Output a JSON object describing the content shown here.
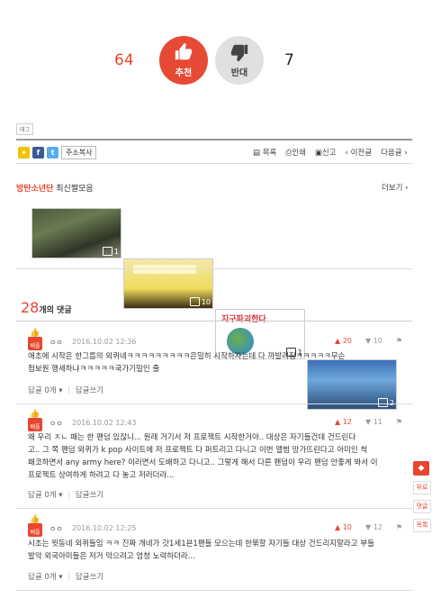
{
  "vote": {
    "up_count": "64",
    "up_label": "추천",
    "down_label": "반대",
    "down_count": "7"
  },
  "tag_label": "태그",
  "share": {
    "copy_address": "주소복사"
  },
  "toolbar": {
    "list": "목록",
    "print": "인쇄",
    "report": "신고",
    "prev": "‹ 이전글",
    "next": "다음글 ›"
  },
  "gallery": {
    "title_highlight": "방탄소년단",
    "title_rest": " 최신짤모음",
    "more": "더보기 ›",
    "items": [
      {
        "count": "1"
      },
      {
        "count": "10"
      },
      {
        "count": "1",
        "caption": "지구파괴한다"
      },
      {
        "count": "2"
      }
    ]
  },
  "comments_header": {
    "count": "28",
    "label": "개의 댓글"
  },
  "comments": [
    {
      "badge": "베플",
      "author": "ㅇㅇ",
      "date": "2016.10.02 12:36",
      "up": "20",
      "down": "10",
      "line1": "애초에 시작은 한그룹의 외퀴네ㅋㅋㅋㅋㅋㅋㅋㅋㅋ은밀히 시작하자는데 다 까발려짐ㅋㅋㅋㅋㅋ무슨",
      "line2": "첩보원 행세하냐ㅋㅋㅋㅋㅋ국가기밀인 줄",
      "line3": "",
      "reply": "답글 0개 ▾",
      "write": "답글쓰기"
    },
    {
      "badge": "베플",
      "author": "ㅇㅇ",
      "date": "2016.10.02 12:43",
      "up": "12",
      "down": "11",
      "line1": "왜 우리 ㅈㄴ 패는 한 팬덤 있잖니... 원래 거기서 저 프로젝트 시작한거야.. 대상은 자기들건데 건드린다",
      "line2": "고.. 그 쪽 팬덤 외퀴가 k pop 사이트에 저 프로젝트 다 퍼트리고 다니고 이번 앨범 망가뜨린다고 아미인 척",
      "line3": "프로젝트 상여하게 하려고 다 놓고 저러더라...",
      "line_mid": "패코하면서 any army here? 이러면서 도배하고 다니고.. 그렇게 해서 다른 팬덤이 우리 팬덤 안좋게 봐서 이",
      "reply": "답글 0개 ▾",
      "write": "답글쓰기"
    },
    {
      "badge": "베플",
      "author": "ㅇㅇ",
      "date": "2016.10.02 12:25",
      "up": "10",
      "down": "12",
      "line1": "시초는 윗동네 외퀴들임 ㅋㅋ 진짜 개네가 갓1세1븐1팬들 모으는데 한묶할 자기들 대상 건드리지말라고 부들",
      "line2": "발악 외국아미들은 저거 막으려고 엄청 노력하더라...",
      "line3": "",
      "reply": "답글 0개 ▾",
      "write": "답글쓰기"
    }
  ],
  "side": {
    "top": "위로",
    "comment": "댓글",
    "list": "목록"
  },
  "colors": {
    "accent": "#e8462f",
    "up_button": "#e64a35",
    "down_button": "#e0e0e0"
  }
}
